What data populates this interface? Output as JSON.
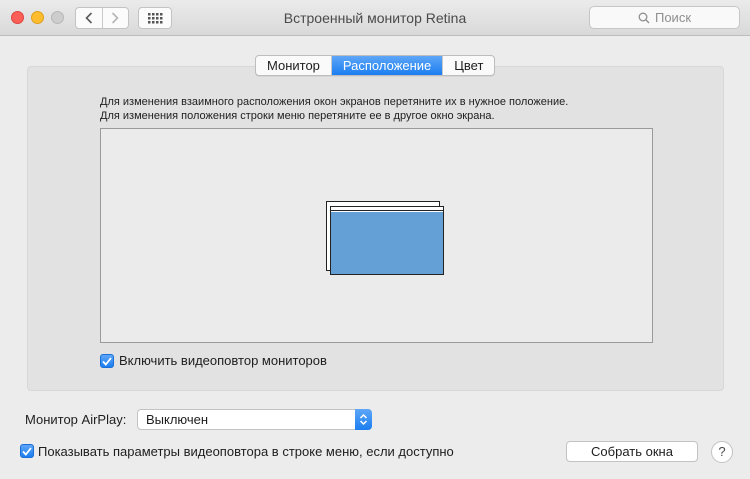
{
  "window": {
    "title": "Встроенный монитор Retina",
    "search_placeholder": "Поиск"
  },
  "tabs": [
    {
      "label": "Монитор",
      "active": false
    },
    {
      "label": "Расположение",
      "active": true
    },
    {
      "label": "Цвет",
      "active": false
    }
  ],
  "arrangement": {
    "hint_line1": "Для изменения взаимного расположения окон экранов перетяните их в нужное положение.",
    "hint_line2": "Для изменения положения строки меню перетяните ее в другое окно экрана.",
    "mirror_checkbox": {
      "label": "Включить видеоповтор мониторов",
      "checked": true
    }
  },
  "airplay": {
    "label": "Монитор AirPlay:",
    "selected": "Выключен"
  },
  "menu_bar_option": {
    "label": "Показывать параметры видеоповтора в строке меню, если доступно",
    "checked": true
  },
  "buttons": {
    "gather_windows": "Собрать окна",
    "help": "?"
  },
  "colors": {
    "accent": "#1b7ef0",
    "display_screen": "#649fd6"
  }
}
